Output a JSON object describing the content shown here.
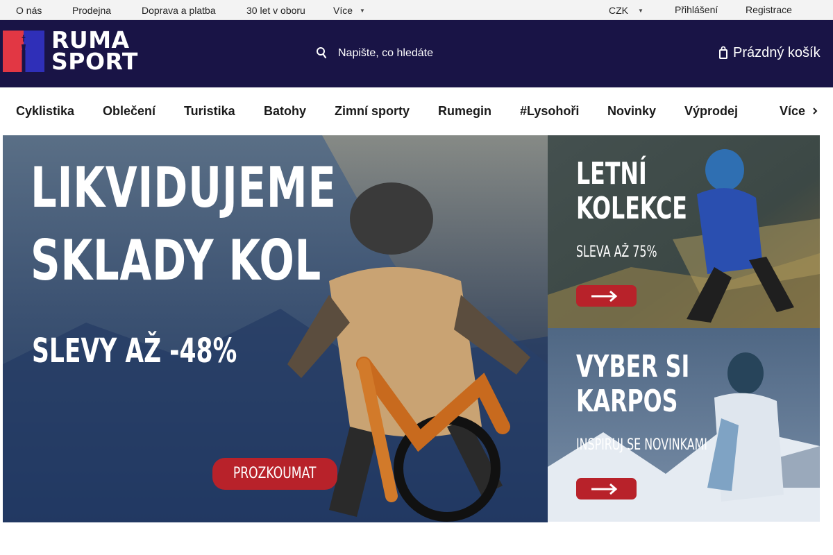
{
  "topbar": {
    "links": [
      "O nás",
      "Prodejna",
      "Doprava a platba",
      "30 let v oboru",
      "Více"
    ],
    "currency": "CZK",
    "login": "Přihlášení",
    "register": "Registrace"
  },
  "header": {
    "logo": {
      "line1": "RUMA",
      "line2": "SPORT"
    },
    "search_placeholder": "Napište, co hledáte",
    "cart_label": "Prázdný košík"
  },
  "nav": {
    "items": [
      "Cyklistika",
      "Oblečení",
      "Turistika",
      "Batohy",
      "Zimní sporty",
      "Rumegin",
      "#Lysohoři",
      "Novinky",
      "Výprodej",
      "Více"
    ]
  },
  "banners": {
    "hero": {
      "line1": "LIKVIDUJEME",
      "line2": "SKLADY KOL",
      "line3": "SLEVY AŽ -48%",
      "cta": "PROZKOUMAT"
    },
    "side1": {
      "line1": "LETNÍ",
      "line2": "KOLEKCE",
      "sub": "SLEVA AŽ 75%"
    },
    "side2": {
      "line1": "VYBER SI",
      "line2": "KARPOS",
      "sub": "INSPIRUJ SE NOVINKAMI"
    }
  },
  "colors": {
    "header_bg": "#191446",
    "accent_red": "#b8222a",
    "logo_red": "#e23744",
    "logo_blue": "#2f2fb8",
    "topbar_bg": "#f3f3f3"
  },
  "icons": {
    "currency_toggle": "caret-down-icon",
    "more_toggle": "caret-down-icon",
    "search": "search-icon",
    "cart": "cart-icon",
    "nav_more": "chevron-right-icon",
    "banner_arrow": "arrow-right-icon"
  }
}
